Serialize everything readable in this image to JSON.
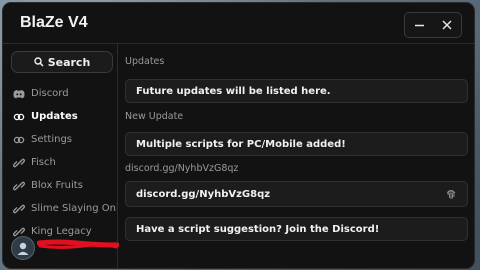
{
  "app": {
    "title": "BlaZe V4"
  },
  "window_controls": {
    "minimize_icon": "minus-icon",
    "close_icon": "close-icon"
  },
  "sidebar": {
    "search_label": "Search",
    "items": [
      {
        "label": "Discord",
        "icon": "discord-icon",
        "active": false
      },
      {
        "label": "Updates",
        "icon": "updates-icon",
        "active": true
      },
      {
        "label": "Settings",
        "icon": "settings-icon",
        "active": false
      },
      {
        "label": "Fisch",
        "icon": "script-icon",
        "active": false
      },
      {
        "label": "Blox Fruits",
        "icon": "script-icon",
        "active": false
      },
      {
        "label": "Slime Slaying Online",
        "icon": "script-icon",
        "active": false
      },
      {
        "label": "King Legacy",
        "icon": "script-icon",
        "active": false
      }
    ]
  },
  "main": {
    "section1_label": "Updates",
    "card1_text": "Future updates will be listed here.",
    "section2_label": "New Update",
    "card2_text": "Multiple scripts for PC/Mobile added!",
    "section3_label": "discord.gg/NyhbVzG8qz",
    "card3_text": "discord.gg/NyhbVzG8qz",
    "card3_icon": "fingerprint-icon",
    "card4_text": "Have a script suggestion? Join the Discord!"
  },
  "colors": {
    "window_bg": "#121212",
    "card_bg": "#1c1c1c",
    "redaction": "#e01020"
  }
}
